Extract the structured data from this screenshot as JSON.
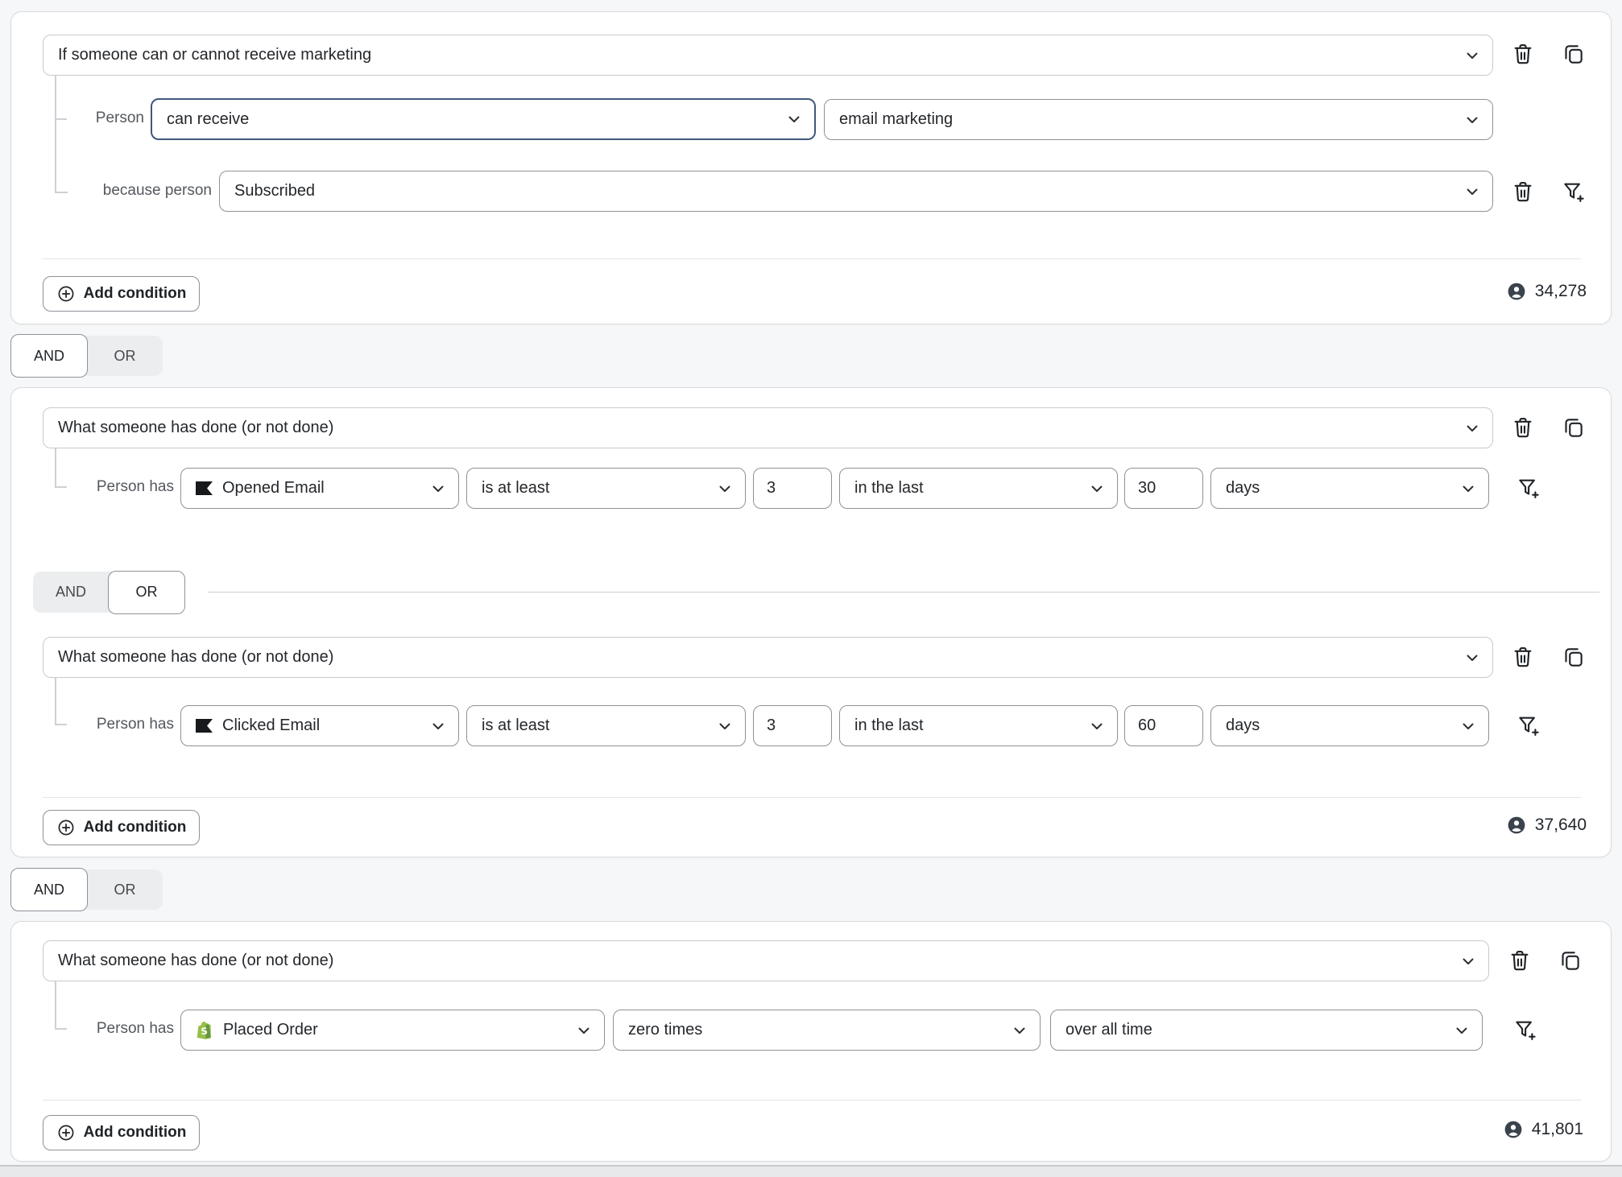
{
  "group1": {
    "category": "If someone can or cannot receive marketing",
    "person_label": "Person",
    "operator": "can receive",
    "channel": "email marketing",
    "because_label": "because person",
    "consent": "Subscribed",
    "add_button": "Add condition",
    "count": "34,278"
  },
  "toggle_top": {
    "and": "AND",
    "or": "OR",
    "selected": "AND"
  },
  "group2": {
    "category": "What someone has done (or not done)",
    "row1": {
      "label": "Person has",
      "event": "Opened Email",
      "comparator": "is at least",
      "quantity": "3",
      "timeframe": "in the last",
      "amount": "30",
      "unit": "days"
    },
    "inner_toggle": {
      "and": "AND",
      "or": "OR",
      "selected": "OR"
    },
    "category2": "What someone has done (or not done)",
    "row2": {
      "label": "Person has",
      "event": "Clicked Email",
      "comparator": "is at least",
      "quantity": "3",
      "timeframe": "in the last",
      "amount": "60",
      "unit": "days"
    },
    "add_button": "Add condition",
    "count": "37,640"
  },
  "toggle_bottom": {
    "and": "AND",
    "or": "OR",
    "selected": "AND"
  },
  "group3": {
    "category": "What someone has done (or not done)",
    "row1": {
      "label": "Person has",
      "event": "Placed Order",
      "comparator": "zero times",
      "timeframe": "over all time"
    },
    "add_button": "Add condition",
    "count": "41,801"
  },
  "icons": {
    "delete": "trash-icon",
    "duplicate": "copy-icon",
    "add_filter": "filter-plus-icon",
    "add": "plus-circle-icon",
    "audience": "person-circle-icon",
    "klaviyo_event": "klaviyo-flag-icon",
    "shopify_event": "shopify-bag-icon",
    "dropdown": "chevron-down-icon"
  },
  "colors": {
    "accent_focus_border": "#40587c",
    "shopify_green": "#95BF47",
    "person_badge": "#3a434c",
    "card_border": "#d8dade"
  }
}
